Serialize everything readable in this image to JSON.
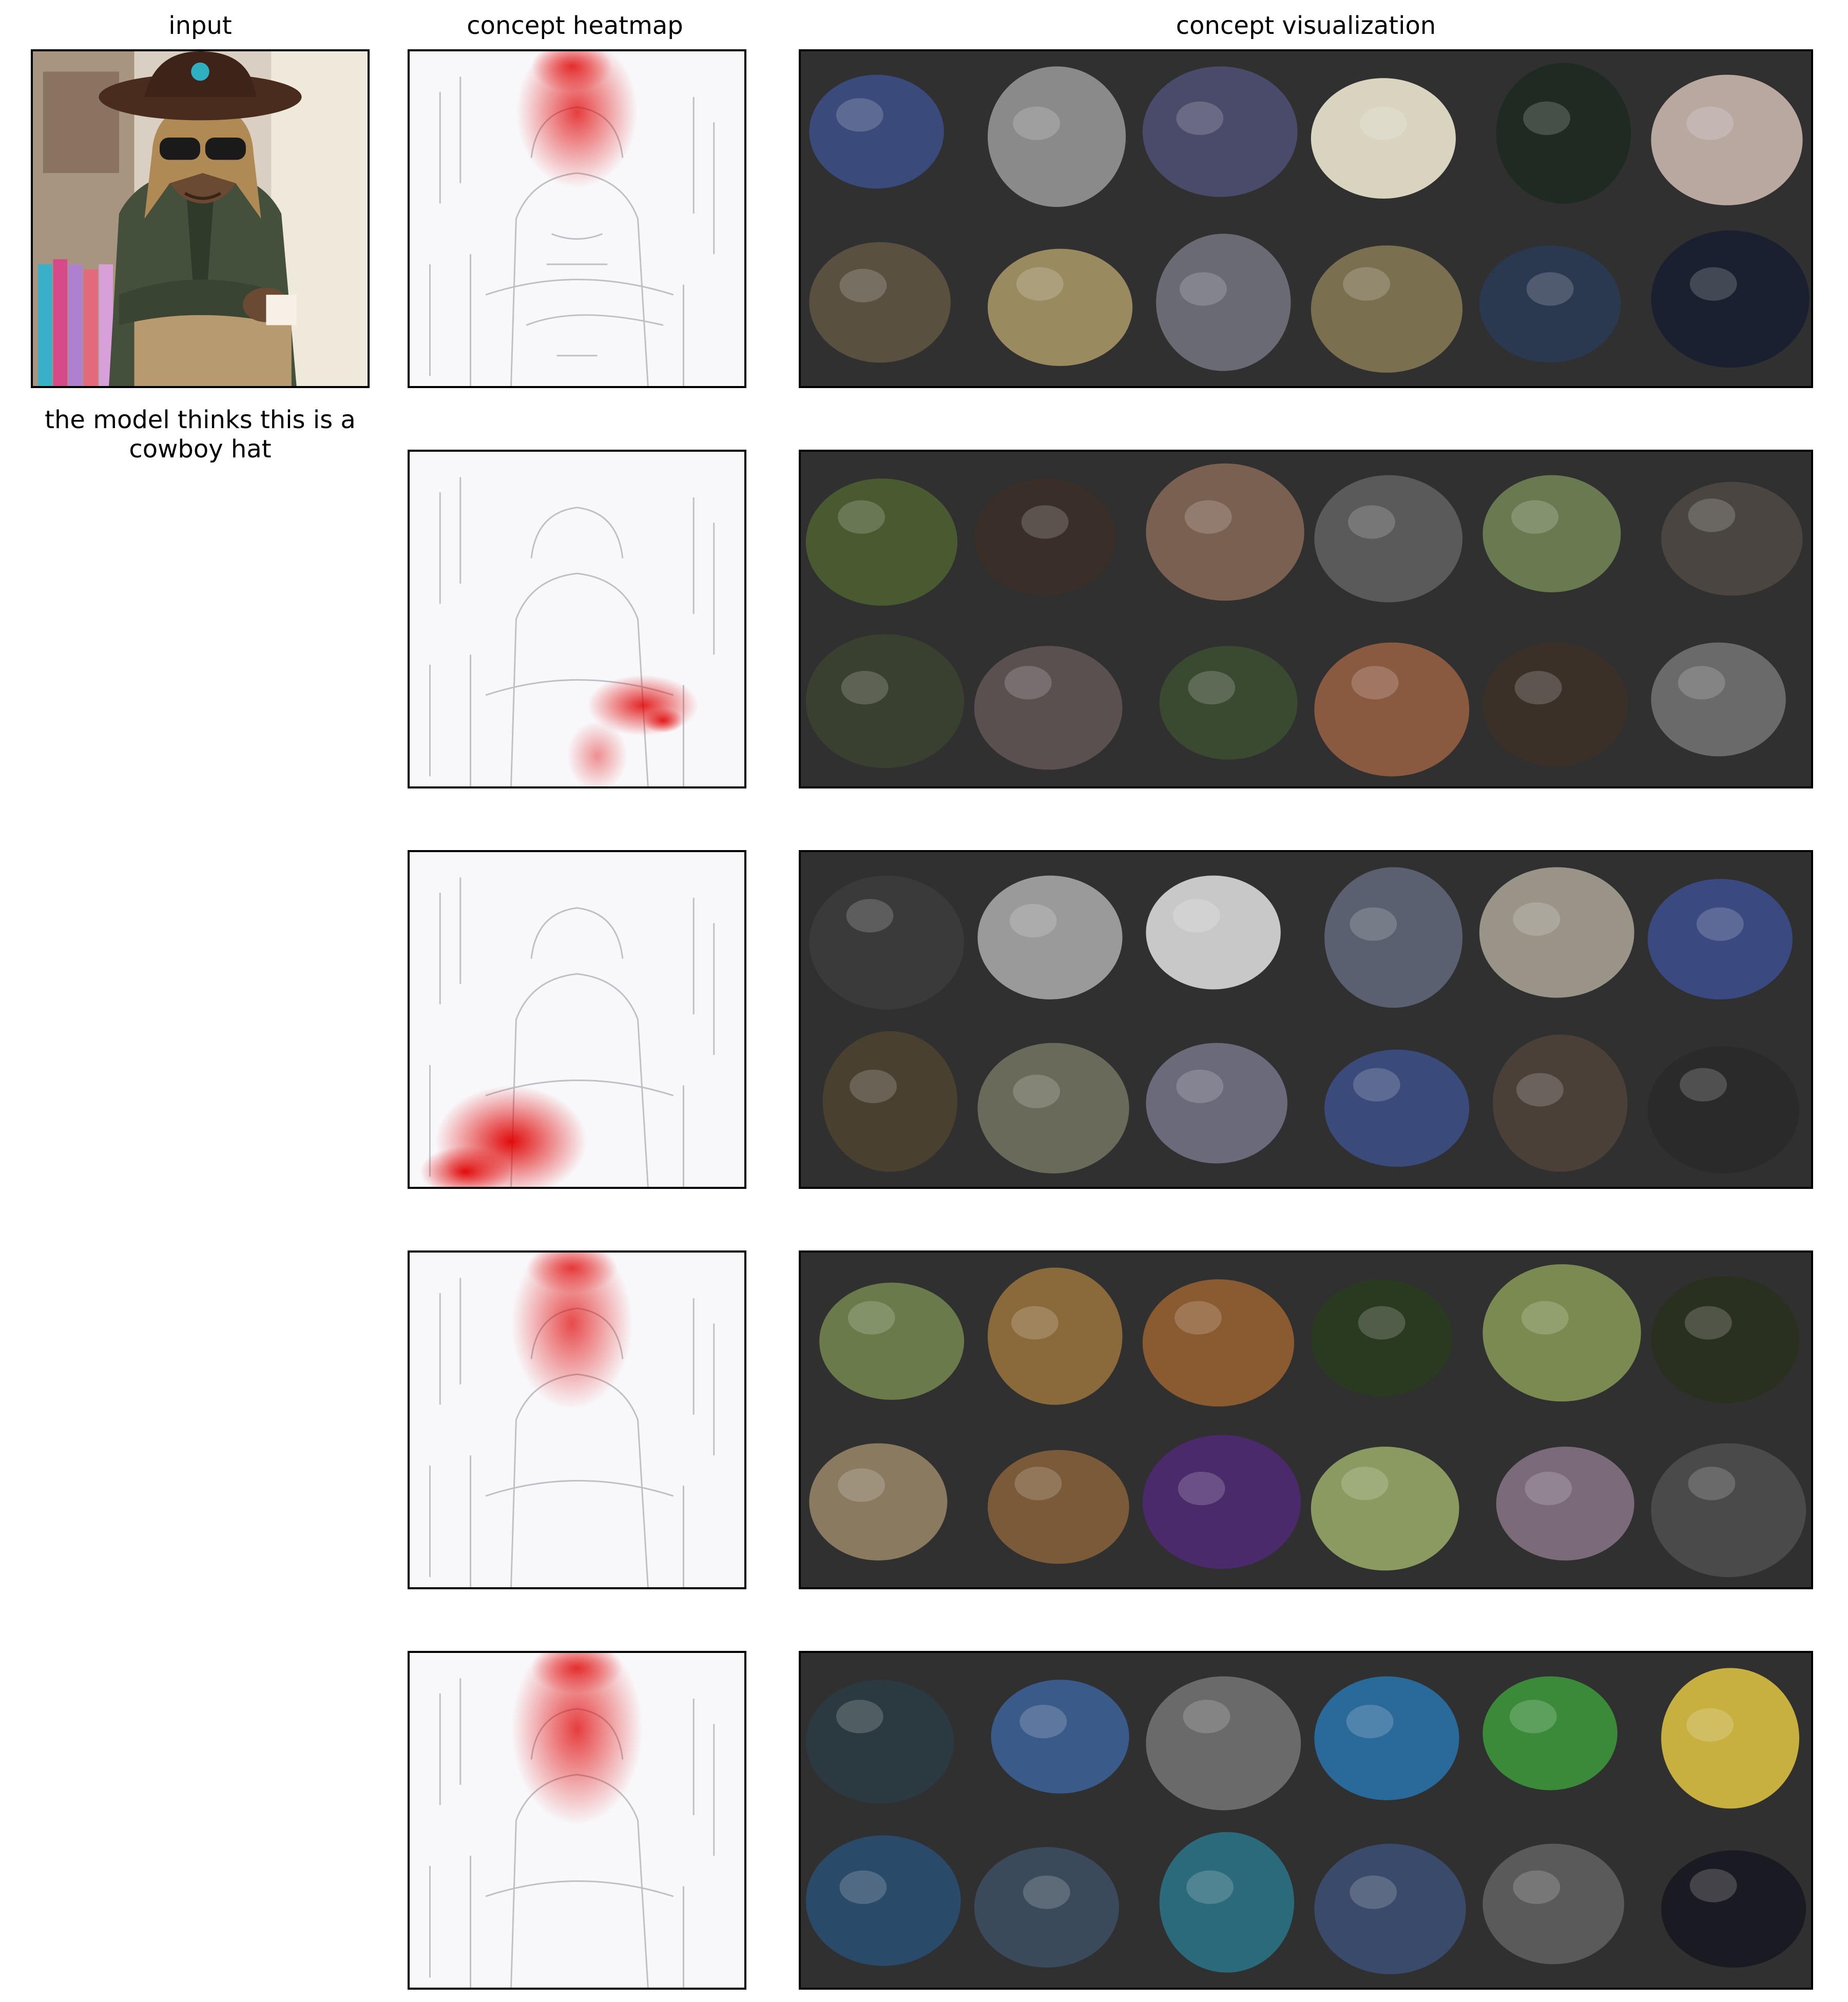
{
  "titles": {
    "input": "input",
    "heatmap": "concept heatmap",
    "visualization": "concept visualization"
  },
  "caption": "the model thinks this is a cowboy hat",
  "concepts": [
    {
      "heatmap_focus": "hat-and-face",
      "tile_colors": [
        "#3a4a7a",
        "#8a8a8a",
        "#4a4a6a",
        "#d8d4c0",
        "#1e2a22",
        "#b8a8a0",
        "#5a5040",
        "#9a8a60",
        "#6a6a74",
        "#7a7050",
        "#2a3850",
        "#1a2030"
      ]
    },
    {
      "heatmap_focus": "forearm",
      "tile_colors": [
        "#4a5a30",
        "#3a2e28",
        "#7a6050",
        "#5a5a5a",
        "#6a7a50",
        "#4a4540",
        "#3a4030",
        "#5a5050",
        "#3a4a30",
        "#8a5a40",
        "#3a3028",
        "#6a6a6a"
      ]
    },
    {
      "heatmap_focus": "lower-left-clothing",
      "tile_colors": [
        "#3a3a3a",
        "#9a9a9a",
        "#c8c8c8",
        "#5a6070",
        "#9a9488",
        "#3a4a80",
        "#4a4030",
        "#6a6a5a",
        "#6a6a7a",
        "#3a4a7a",
        "#4a4038",
        "#2a2a2a"
      ]
    },
    {
      "heatmap_focus": "hat-and-face",
      "tile_colors": [
        "#6a7a4a",
        "#8a6a3a",
        "#8a5a30",
        "#2a3a20",
        "#7a8a50",
        "#2a3020",
        "#8a7a60",
        "#7a5a38",
        "#4a2a6a",
        "#8a9a60",
        "#7a6a7a",
        "#4a4a4a"
      ]
    },
    {
      "heatmap_focus": "hat-and-face",
      "tile_colors": [
        "#2a3a40",
        "#3a5a8a",
        "#6a6a6a",
        "#2a6a9a",
        "#3a8a3a",
        "#c8b040",
        "#2a4a6a",
        "#3a4a5a",
        "#2a6a7a",
        "#3a4a6a",
        "#5a5a5a",
        "#1a1a22"
      ]
    }
  ]
}
